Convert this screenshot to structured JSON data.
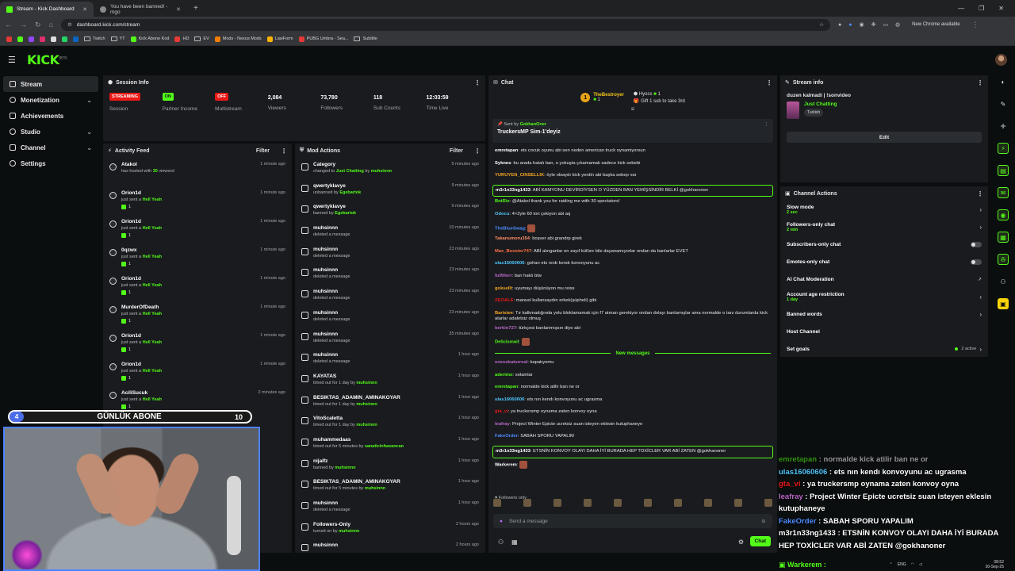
{
  "browser": {
    "tabs": [
      {
        "title": "Stream - Kick Dashboard",
        "active": true
      },
      {
        "title": "You have been banned! - mgo",
        "active": false
      }
    ],
    "url": "dashboard.kick.com/stream",
    "update_label": "New Chrome available",
    "bookmarks": [
      "Twitch",
      "YT",
      "Kick Abone Kod",
      "HD",
      "EV",
      "Mods - Nexus Mods",
      "LawForm",
      "PUBG Umbra - Sea...",
      "Subtitle"
    ]
  },
  "app": {
    "logo": "KICK",
    "logo_badge": "BETA"
  },
  "sidebar": {
    "items": [
      {
        "label": "Stream",
        "active": true,
        "expandable": false
      },
      {
        "label": "Monetization",
        "active": false,
        "expandable": true
      },
      {
        "label": "Achievements",
        "active": false,
        "expandable": false
      },
      {
        "label": "Studio",
        "active": false,
        "expandable": true
      },
      {
        "label": "Channel",
        "active": false,
        "expandable": true
      },
      {
        "label": "Settings",
        "active": false,
        "expandable": false
      }
    ]
  },
  "session_info": {
    "title": "Session Info",
    "stats": [
      {
        "value": "STREAMING",
        "kind": "red-pill",
        "label": "Session"
      },
      {
        "value": "ON",
        "kind": "green-pill",
        "label": "Partner Income"
      },
      {
        "value": "OFF",
        "kind": "red-pill",
        "label": "Multistream"
      },
      {
        "value": "2,084",
        "kind": "text",
        "label": "Viewers"
      },
      {
        "value": "73,780",
        "kind": "text",
        "label": "Followers"
      },
      {
        "value": "118",
        "kind": "text",
        "label": "Sub Counts"
      },
      {
        "value": "12:03:59",
        "kind": "text",
        "label": "Time Live"
      }
    ]
  },
  "activity_feed": {
    "title": "Activity Feed",
    "filter_label": "Filter",
    "items": [
      {
        "user": "Atakol",
        "pre": "has hosted with ",
        "hl": "30",
        "post": " viewers!",
        "time": "1 minute ago",
        "badge": ""
      },
      {
        "user": "Orion1d",
        "pre": "just sent a ",
        "hl": "Hell Yeah",
        "post": "",
        "time": "1 minute ago",
        "badge": "1"
      },
      {
        "user": "Orion1d",
        "pre": "just sent a ",
        "hl": "Hell Yeah",
        "post": "",
        "time": "1 minute ago",
        "badge": "1"
      },
      {
        "user": "0qzwx",
        "pre": "just sent a ",
        "hl": "Hell Yeah",
        "post": "",
        "time": "1 minute ago",
        "badge": "1"
      },
      {
        "user": "Orion1d",
        "pre": "just sent a ",
        "hl": "Hell Yeah",
        "post": "",
        "time": "1 minute ago",
        "badge": "1"
      },
      {
        "user": "MurderOfDeath",
        "pre": "just sent a ",
        "hl": "Hell Yeah",
        "post": "",
        "time": "1 minute ago",
        "badge": "1"
      },
      {
        "user": "Orion1d",
        "pre": "just sent a ",
        "hl": "Hell Yeah",
        "post": "",
        "time": "1 minute ago",
        "badge": "1"
      },
      {
        "user": "Orion1d",
        "pre": "just sent a ",
        "hl": "Hell Yeah",
        "post": "",
        "time": "1 minute ago",
        "badge": "1"
      },
      {
        "user": "AciliSucuk",
        "pre": "just sent a ",
        "hl": "Hell Yeah",
        "post": "",
        "time": "2 minutes ago",
        "badge": "1"
      }
    ]
  },
  "mod_actions": {
    "title": "Mod Actions",
    "filter_label": "Filter",
    "items": [
      {
        "title": "Category",
        "pre": "changed to ",
        "hl": "Just Chatting",
        "mid": " by ",
        "hl2": "muhsinnn",
        "time": "5 minutes ago"
      },
      {
        "title": "qwertyklavye",
        "pre": "unbanned by ",
        "hl": "Egebartok",
        "mid": "",
        "hl2": "",
        "time": "9 minutes ago"
      },
      {
        "title": "qwertyklavye",
        "pre": "banned by ",
        "hl": "Egebartok",
        "mid": "",
        "hl2": "",
        "time": "9 minutes ago"
      },
      {
        "title": "muhsinnn",
        "pre": "deleted a message",
        "hl": "",
        "mid": "",
        "hl2": "",
        "time": "10 minutes ago"
      },
      {
        "title": "muhsinnn",
        "pre": "deleted a message",
        "hl": "",
        "mid": "",
        "hl2": "",
        "time": "23 minutes ago"
      },
      {
        "title": "muhsinnn",
        "pre": "deleted a message",
        "hl": "",
        "mid": "",
        "hl2": "",
        "time": "23 minutes ago"
      },
      {
        "title": "muhsinnn",
        "pre": "deleted a message",
        "hl": "",
        "mid": "",
        "hl2": "",
        "time": "23 minutes ago"
      },
      {
        "title": "muhsinnn",
        "pre": "deleted a message",
        "hl": "",
        "mid": "",
        "hl2": "",
        "time": "23 minutes ago"
      },
      {
        "title": "muhsinnn",
        "pre": "deleted a message",
        "hl": "",
        "mid": "",
        "hl2": "",
        "time": "35 minutes ago"
      },
      {
        "title": "muhsinnn",
        "pre": "deleted a message",
        "hl": "",
        "mid": "",
        "hl2": "",
        "time": "1 hour ago"
      },
      {
        "title": "KAYATAS",
        "pre": "timed out for 1 day by ",
        "hl": "muhsinnn",
        "mid": "",
        "hl2": "",
        "time": "1 hour ago"
      },
      {
        "title": "BESIKTAS_ADAMIN_AMINAKOYAR",
        "pre": "timed out for 1 day by ",
        "hl": "muhsinnn",
        "mid": "",
        "hl2": "",
        "time": "1 hour ago"
      },
      {
        "title": "VitoScaletta",
        "pre": "timed out for 1 day by ",
        "hl": "muhsinnn",
        "mid": "",
        "hl2": "",
        "time": "1 hour ago"
      },
      {
        "title": "muhammedaas",
        "pre": "timed out for 5 minutes by ",
        "hl": "sanaticinhasancan",
        "mid": "",
        "hl2": "",
        "time": "1 hour ago"
      },
      {
        "title": "nijalfz",
        "pre": "banned by ",
        "hl": "muhsinnn",
        "mid": "",
        "hl2": "",
        "time": "1 hour ago"
      },
      {
        "title": "BESIKTAS_ADAMIN_AMINAKOYAR",
        "pre": "timed out for 5 minutes by ",
        "hl": "muhsinnn",
        "mid": "",
        "hl2": "",
        "time": "1 hour ago"
      },
      {
        "title": "muhsinnn",
        "pre": "deleted a message",
        "hl": "",
        "mid": "",
        "hl2": "",
        "time": "1 hour ago"
      },
      {
        "title": "Followers-Only",
        "pre": "turned on by ",
        "hl": "muhsinnn",
        "mid": "",
        "hl2": "",
        "time": "2 hours ago"
      },
      {
        "title": "muhsinnn",
        "pre": "",
        "hl": "",
        "mid": "",
        "hl2": "",
        "time": "2 hours ago"
      }
    ]
  },
  "chat": {
    "title": "Chat",
    "top_gifter": {
      "name": "TheBestroyer",
      "rank": "1",
      "count": "1"
    },
    "gift_entry": {
      "name": "Hyoss",
      "count": "1",
      "cta": "Gift 1 sub to take 3rd"
    },
    "pinned": {
      "sent_by_label": "Sent by",
      "sent_by_user": "GokhanOner",
      "text": "TruckersMP Sim-1'deyiz"
    },
    "messages": [
      {
        "user": "emretapan",
        "color": "#ffffff",
        "text": "ets cocuk oyunu abi sen neden american truck oynamiyorsun",
        "boxed": false
      },
      {
        "user": "Syknes",
        "color": "#ffffff",
        "text": "bu arada hatalı ban, o yokuşta çıkamamak sadece kick sebebi",
        "boxed": false
      },
      {
        "user": "YURUYEN_CINSELLIK",
        "color": "#f5a623",
        "text": "öyle olsaydı kick yerdin abi başka sebep var",
        "boxed": false
      },
      {
        "user": "m3r1n33ng1433",
        "color": "#ffffff",
        "text": "ABİ KAMYONU DEVİRDİYSEN O YÜZDEN BAN YEMİŞSİNDİR BELKİ @gokhanoner",
        "boxed": true
      },
      {
        "user": "BotRix",
        "color": "#53fc18",
        "text": "@Atakol thank you for raiding me with 30 spectators!",
        "boxed": false
      },
      {
        "user": "Odocu",
        "color": "#4fc3f7",
        "text": "4×2yle 60 ton çekiyon abi aq",
        "boxed": false
      },
      {
        "user": "TheBlueSwag",
        "color": "#4f8bff",
        "text": "",
        "boxed": false
      },
      {
        "user": "Takanumoru354",
        "color": "#ff8a65",
        "text": "boşver abi grandrp girek",
        "boxed": false
      },
      {
        "user": "Max_Booster747",
        "color": "#ff7043",
        "text": "ABİ alınganlar en zayıf küfüre bile dayanamıyorlar ondan da banlarlar EVET",
        "boxed": false
      },
      {
        "user": "ulas16060606",
        "color": "#4fc3f7",
        "text": "gohan ets nınb kendı konvoyunu ac",
        "boxed": false
      },
      {
        "user": "fulfillerr",
        "color": "#ba68c8",
        "text": "ban haklı btw",
        "boxed": false
      },
      {
        "user": "goksellt",
        "color": "#f5a623",
        "text": "uyumayı düşünüyon mu reiss",
        "boxed": false
      },
      {
        "user": "ZEOALE",
        "color": "#e91916",
        "text": "manuel kullansaydın erkek(şüpheli) gibi",
        "boxed": false
      },
      {
        "user": "Baristee",
        "color": "#f5a623",
        "text": "Tır kalkmadığında yolu bloklamamak için f7 atman gerekiyor ondan dolayı banlamışlar ama normalde o tarz durumlarda kick atarlar adaletsiz olmuş",
        "boxed": false
      },
      {
        "user": "berkin727",
        "color": "#ba68c8",
        "text": "türkçesi banlanmışsın diyo abi",
        "boxed": false
      },
      {
        "user": "Delicismail",
        "color": "#53fc18",
        "text": "",
        "boxed": false
      }
    ],
    "new_messages_label": "New messages",
    "new_messages": [
      {
        "user": "enessbaturreal",
        "color": "#ba68c8",
        "text": "kapatıyomu",
        "boxed": false
      },
      {
        "user": "aderimo",
        "color": "#53fc18",
        "text": "selamlar",
        "boxed": false
      },
      {
        "user": "emretapan",
        "color": "#53fc18",
        "text": "normalde kick atilir ban ne or",
        "boxed": false
      },
      {
        "user": "ulas16060606",
        "color": "#4fc3f7",
        "text": "ets nın kendı konvoyunu ac ugrasma",
        "boxed": false
      },
      {
        "user": "gta_vi",
        "color": "#e91916",
        "text": "ya truckersmp oynama zaten konvoy oyna",
        "boxed": false
      },
      {
        "user": "leafray",
        "color": "#ba68c8",
        "text": "Project Winter Epicte ucretsiz suan isteyen eklesin kutuphaneye",
        "boxed": false
      },
      {
        "user": "FakeOrder",
        "color": "#4f8bff",
        "text": "SABAH SPORU YAPALIM",
        "boxed": false
      },
      {
        "user": "m3r1n33ng1433",
        "color": "#ffffff",
        "text": "ETSNİN KONVOY OLAYI DAHA İYİ BURADA HEP TOXİCLER VAR ABİ ZATEN @gokhanoner",
        "boxed": true
      },
      {
        "user": "Warkerem",
        "color": "#ffffff",
        "text": "",
        "boxed": false
      }
    ],
    "followers_only_label": "Followers only",
    "input_placeholder": "Send a message",
    "send_label": "Chat"
  },
  "stream_info": {
    "title": "Stream info",
    "stream_title": "duzen kalmadi | !sonvideo",
    "category": "Just Chatting",
    "language_tag": "Turkish",
    "edit_label": "Edit"
  },
  "channel_actions": {
    "title": "Channel Actions",
    "items": [
      {
        "label": "Slow mode",
        "sub": "2 sec",
        "right": "chevron"
      },
      {
        "label": "Followers-only chat",
        "sub": "2 min",
        "right": "chevron"
      },
      {
        "label": "Subscribers-only chat",
        "sub": "",
        "right": "toggle"
      },
      {
        "label": "Emotes-only chat",
        "sub": "",
        "right": "toggle"
      },
      {
        "label": "AI Chat Moderation",
        "sub": "",
        "right": "external"
      },
      {
        "label": "Account age restriction",
        "sub": "1 day",
        "right": "chevron"
      },
      {
        "label": "Banned words",
        "sub": "",
        "right": "chevron"
      },
      {
        "label": "Host Channel",
        "sub": "",
        "right": "none"
      },
      {
        "label": "Set goals",
        "sub": "",
        "right": "active",
        "active_text": "2 active"
      }
    ]
  },
  "overlay": {
    "sub_goal": {
      "current": "4",
      "label": "GÜNLÜK ABONE",
      "target": "10"
    },
    "chat": [
      {
        "user": "emretapan",
        "color": "#53fc18",
        "text": "normalde kick atilir ban ne or",
        "dim": true
      },
      {
        "user": "ulas16060606",
        "color": "#4fc3f7",
        "text": "ets nın kendı konvoyunu ac ugrasma",
        "dim": false
      },
      {
        "user": "gta_vi",
        "color": "#e91916",
        "text": "ya truckersmp oynama zaten konvoy oyna",
        "dim": false
      },
      {
        "user": "leafray",
        "color": "#ba68c8",
        "text": "Project Winter Epicte ucretsiz suan isteyen eklesin kutuphaneye",
        "dim": false
      },
      {
        "user": "FakeOrder",
        "color": "#4f8bff",
        "text": "SABAH SPORU YAPALIM",
        "dim": false
      },
      {
        "user": "m3r1n33ng1433",
        "color": "#ffffff",
        "text": "ETSNİN KONVOY OLAYI DAHA İYİ BURADA HEP TOXİCLER VAR ABİ ZATEN @gokhanoner",
        "dim": false
      }
    ],
    "last_user": "Warkerem"
  },
  "taskbar": {
    "lang": "ENG",
    "time": "08:52",
    "date": "20-Sep-25"
  },
  "colors": {
    "kick_green": "#53fc18",
    "bg": "#0b0e0f",
    "panel": "#191b1f",
    "live_red": "#e91916",
    "webcam_border": "#4d82ff"
  }
}
